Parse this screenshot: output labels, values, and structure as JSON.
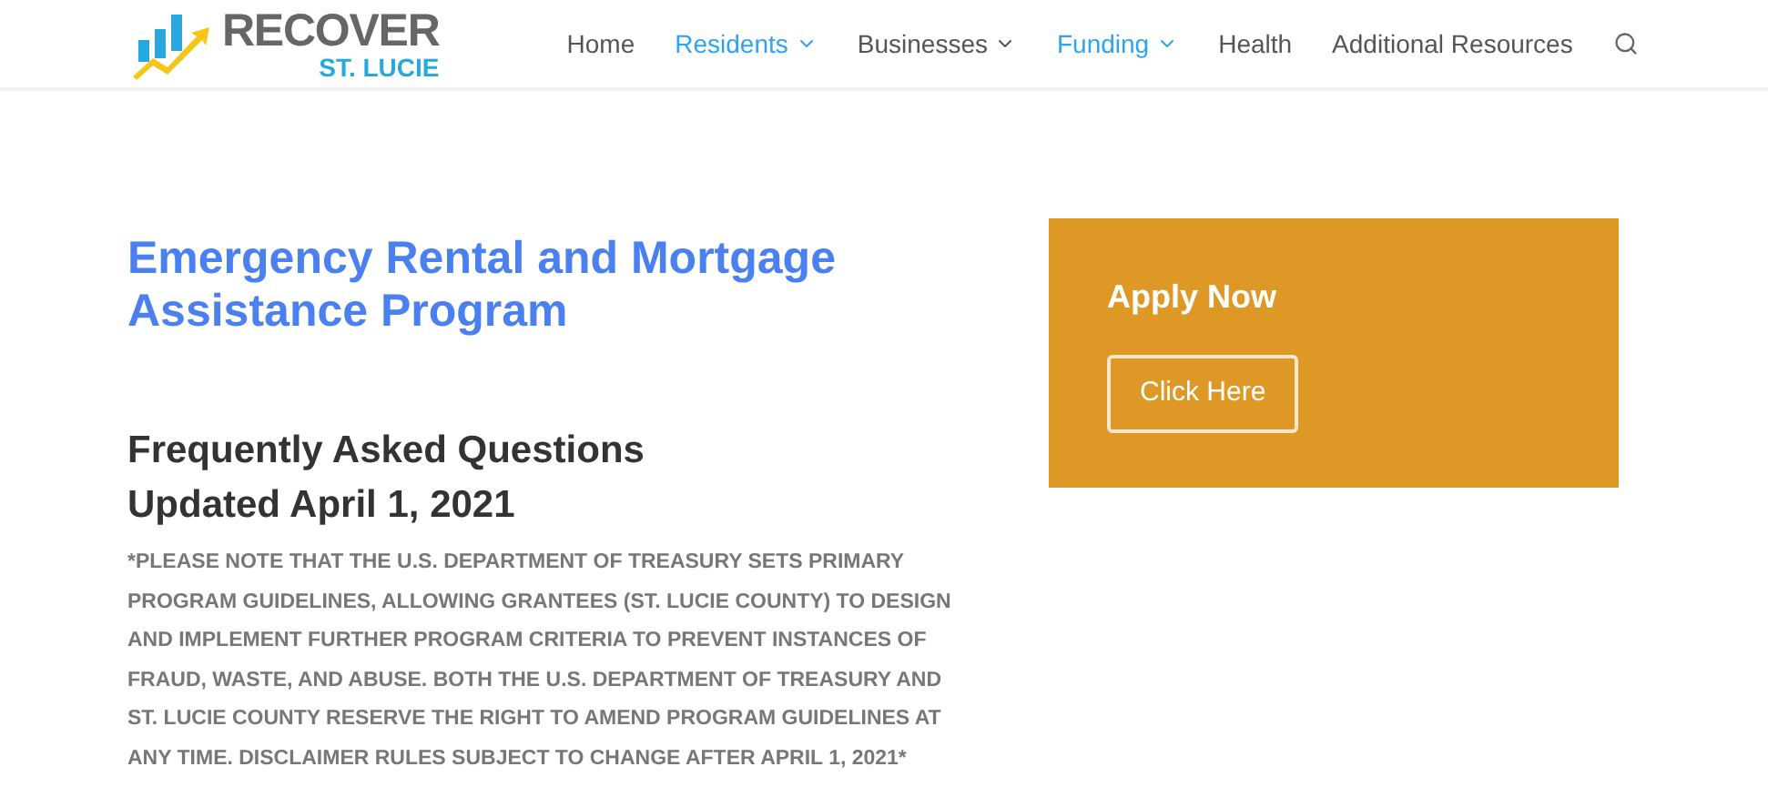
{
  "logo": {
    "title": "RECOVER",
    "subtitle": "ST. LUCIE"
  },
  "nav": [
    {
      "label": "Home",
      "selected": false,
      "has_dropdown": false
    },
    {
      "label": "Residents",
      "selected": true,
      "has_dropdown": true
    },
    {
      "label": "Businesses",
      "selected": false,
      "has_dropdown": true
    },
    {
      "label": "Funding",
      "selected": true,
      "has_dropdown": true
    },
    {
      "label": "Health",
      "selected": false,
      "has_dropdown": false
    },
    {
      "label": "Additional Resources",
      "selected": false,
      "has_dropdown": false
    }
  ],
  "page_title": "Emergency Rental and Mortgage Assistance Program",
  "faq_heading": "Frequently Asked Questions",
  "updated": "Updated April 1, 2021",
  "disclaimer": "*PLEASE NOTE THAT THE U.S. DEPARTMENT OF TREASURY SETS PRIMARY PROGRAM GUIDELINES, ALLOWING GRANTEES (ST. LUCIE COUNTY) TO DESIGN AND IMPLEMENT FURTHER PROGRAM CRITERIA TO PREVENT INSTANCES OF FRAUD, WASTE, AND ABUSE. BOTH THE U.S. DEPARTMENT OF TREASURY AND ST. LUCIE COUNTY RESERVE THE RIGHT TO AMEND PROGRAM GUIDELINES AT ANY TIME. DISCLAIMER RULES SUBJECT TO CHANGE AFTER APRIL 1, 2021*",
  "apply_card": {
    "heading": "Apply Now",
    "button": "Click Here"
  }
}
